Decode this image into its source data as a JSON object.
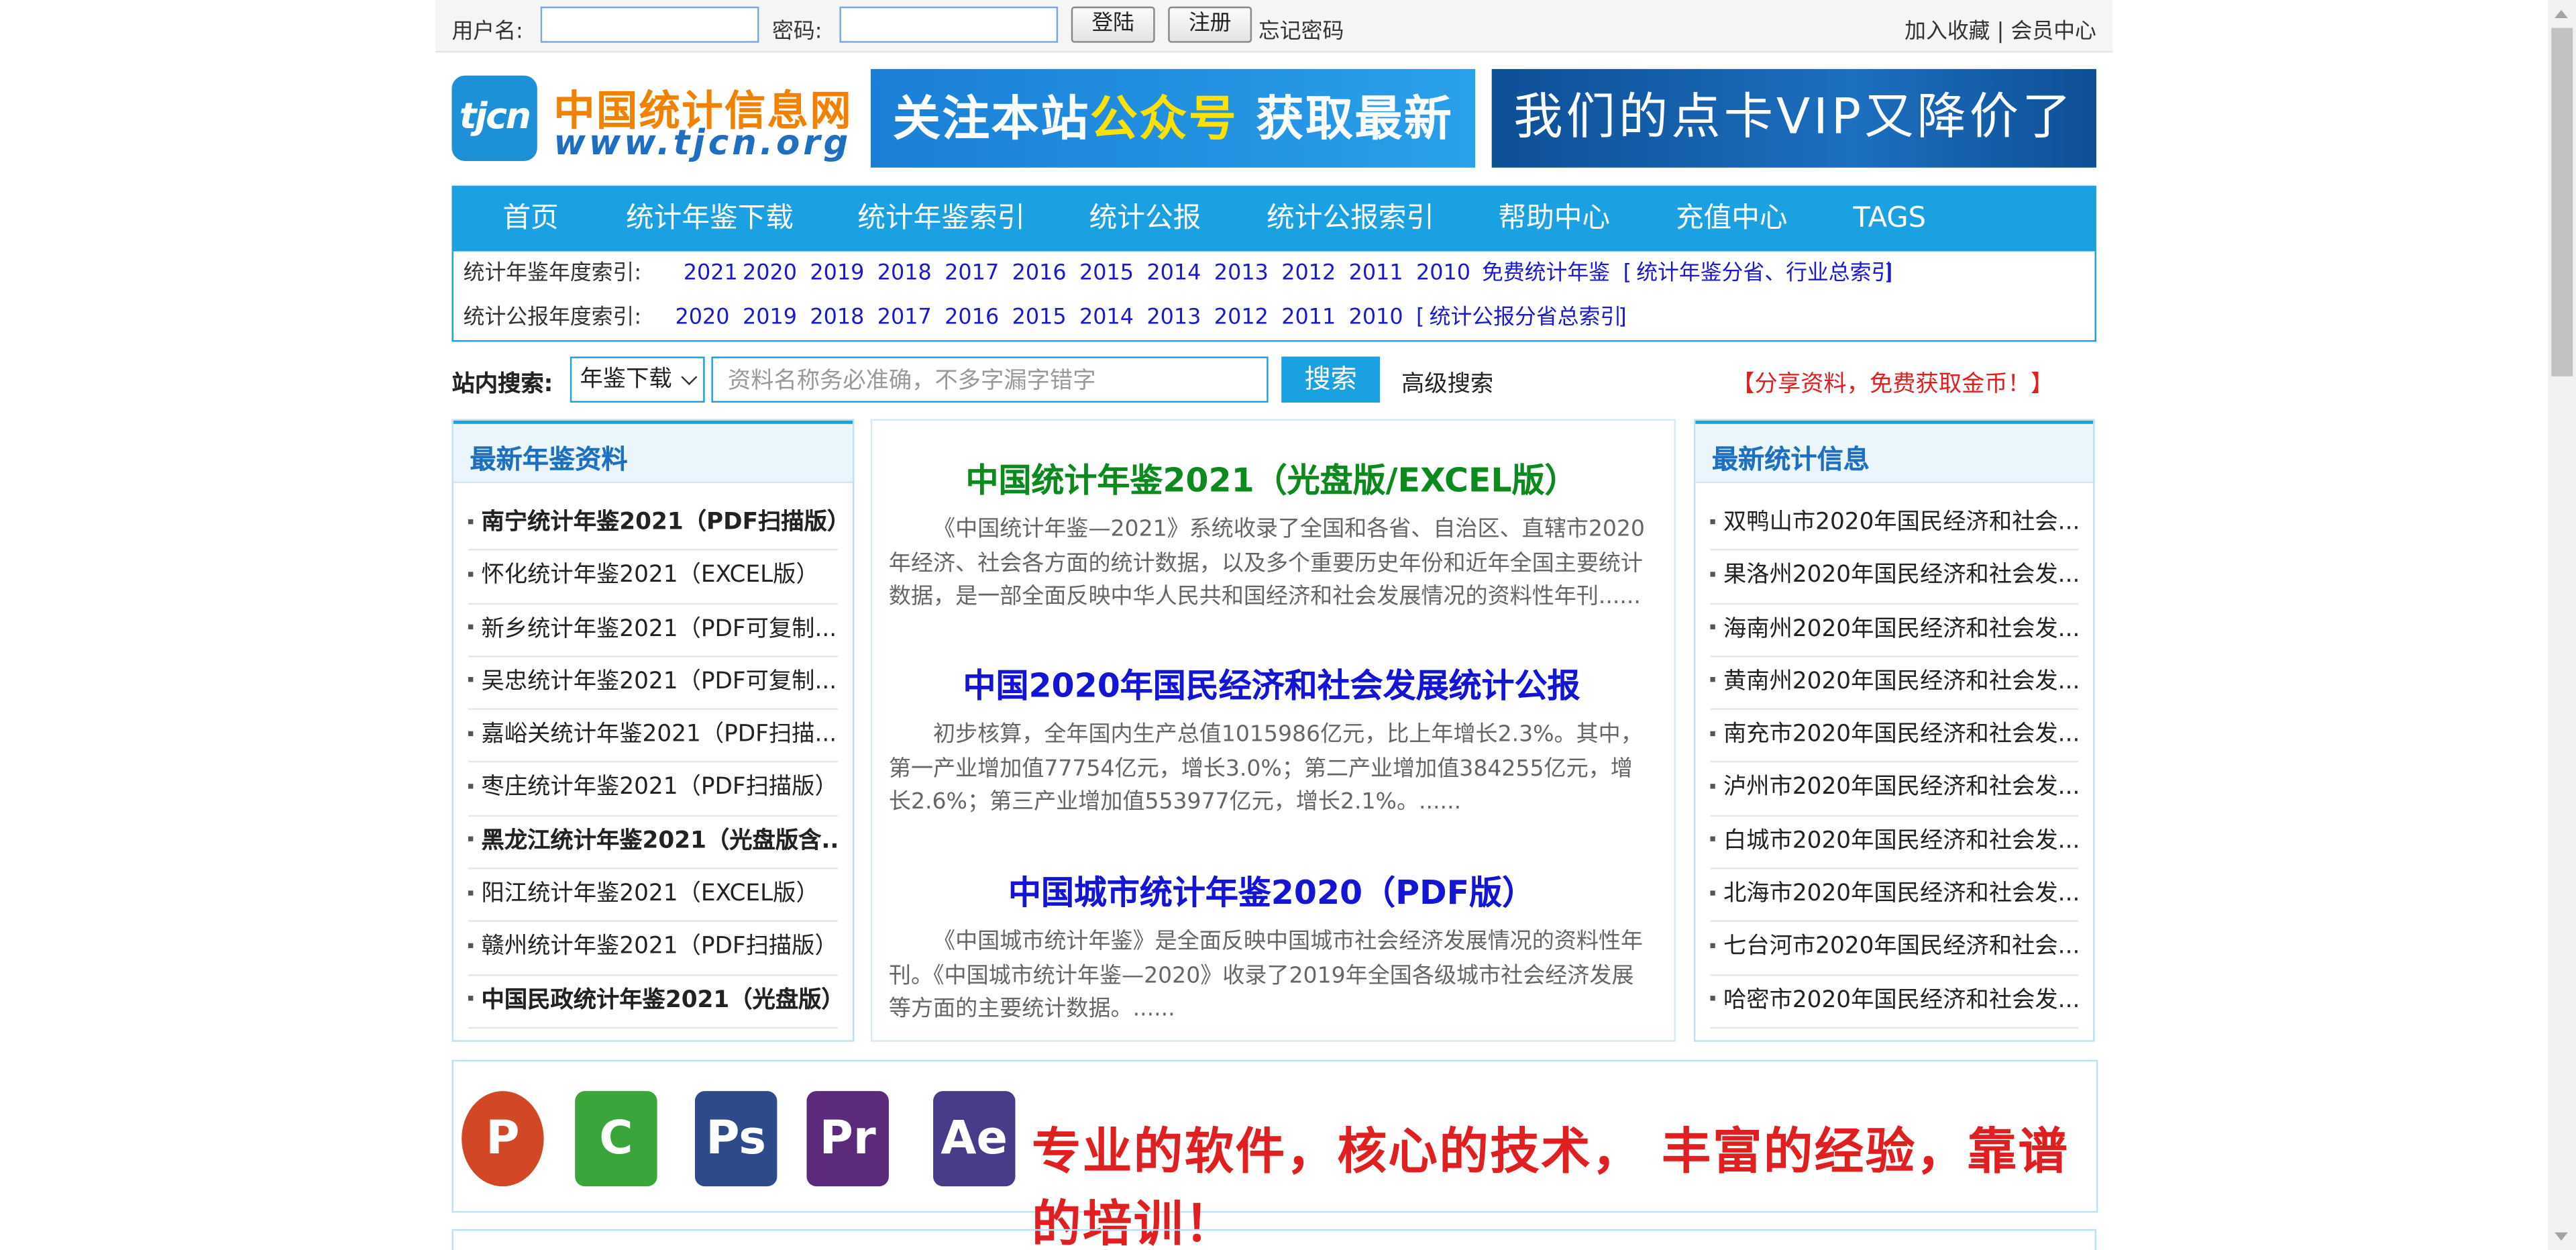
{
  "topbar": {
    "username_label": "用户名:",
    "password_label": "密码:",
    "login_label": "登陆",
    "register_label": "注册",
    "forgot_label": "忘记密码",
    "favorite_label": "加入收藏",
    "separator": " | ",
    "member_label": "会员中心"
  },
  "header": {
    "logo_mark": "tjcn",
    "logo_cn": "中国统计信息网",
    "logo_en": "www.tjcn.org",
    "banner1_pre": "关注本站",
    "banner1_hl": "公众号",
    "banner1_post": " 获取最新动态",
    "banner2": "我们的点卡VIP又降价了"
  },
  "nav": {
    "items": [
      "首页",
      "统计年鉴下载",
      "统计年鉴索引",
      "统计公报",
      "统计公报索引",
      "帮助中心",
      "充值中心",
      "TAGS"
    ]
  },
  "index": {
    "yearbook_label": "统计年鉴年度索引:",
    "yearbook_years": [
      "2021",
      "2020",
      "2019",
      "2018",
      "2017",
      "2016",
      "2015",
      "2014",
      "2013",
      "2012",
      "2011",
      "2010"
    ],
    "yearbook_free": "免费统计年鉴",
    "yearbook_total": "统计年鉴分省、行业总索引",
    "bulletin_label": "统计公报年度索引:",
    "bulletin_years": [
      "2020",
      "2019",
      "2018",
      "2017",
      "2016",
      "2015",
      "2014",
      "2013",
      "2012",
      "2011",
      "2010"
    ],
    "bulletin_total": "统计公报分省总索引",
    "bracket_open": "[",
    "bracket_close": "]"
  },
  "search": {
    "label": "站内搜索:",
    "select_value": "年鉴下载",
    "placeholder": "资料名称务必准确，不多字漏字错字",
    "button": "搜索",
    "advanced": "高级搜索",
    "promo": "【分享资料，免费获取金币！】"
  },
  "left_panel": {
    "title": "最新年鉴资料",
    "items": [
      {
        "text": "南宁统计年鉴2021（PDF扫描版）",
        "bold": true
      },
      {
        "text": "怀化统计年鉴2021（EXCEL版）",
        "bold": false
      },
      {
        "text": "新乡统计年鉴2021（PDF可复制...",
        "bold": false
      },
      {
        "text": "吴忠统计年鉴2021（PDF可复制...",
        "bold": false
      },
      {
        "text": "嘉峪关统计年鉴2021（PDF扫描...",
        "bold": false
      },
      {
        "text": "枣庄统计年鉴2021（PDF扫描版）",
        "bold": false
      },
      {
        "text": "黑龙江统计年鉴2021（光盘版含...",
        "bold": true
      },
      {
        "text": "阳江统计年鉴2021（EXCEL版）",
        "bold": false
      },
      {
        "text": "赣州统计年鉴2021（PDF扫描版）",
        "bold": false
      },
      {
        "text": "中国民政统计年鉴2021（光盘版）",
        "bold": true
      }
    ]
  },
  "center": {
    "articles": [
      {
        "title": "中国统计年鉴2021（光盘版/EXCEL版）",
        "color": "#0c8a1e",
        "desc": "《中国统计年鉴—2021》系统收录了全国和各省、自治区、直辖市2020年经济、社会各方面的统计数据，以及多个重要历史年份和近年全国主要统计数据，是一部全面反映中华人民共和国经济和社会发展情况的资料性年刊......"
      },
      {
        "title": "中国2020年国民经济和社会发展统计公报",
        "color": "#1414d4",
        "desc": "初步核算，全年国内生产总值1015986亿元，比上年增长2.3%。其中，第一产业增加值77754亿元，增长3.0%；第二产业增加值384255亿元，增长2.6%；第三产业增加值553977亿元，增长2.1%。......"
      },
      {
        "title": "中国城市统计年鉴2020（PDF版）",
        "color": "#1414d4",
        "desc": "《中国城市统计年鉴》是全面反映中国城市社会经济发展情况的资料性年刊。《中国城市统计年鉴—2020》收录了2019年全国各级城市社会经济发展等方面的主要统计数据。......"
      }
    ]
  },
  "right_panel": {
    "title": "最新统计信息",
    "items": [
      "双鸭山市2020年国民经济和社会...",
      "果洛州2020年国民经济和社会发...",
      "海南州2020年国民经济和社会发...",
      "黄南州2020年国民经济和社会发...",
      "南充市2020年国民经济和社会发...",
      "泸州市2020年国民经济和社会发...",
      "白城市2020年国民经济和社会发...",
      "北海市2020年国民经济和社会发...",
      "七台河市2020年国民经济和社会...",
      "哈密市2020年国民经济和社会发..."
    ]
  },
  "ad": {
    "icons": [
      {
        "name": "powerpoint-icon",
        "glyph": "P",
        "color": "#d24726"
      },
      {
        "name": "camtasia-icon",
        "glyph": "C",
        "color": "#3aa53a"
      },
      {
        "name": "photoshop-icon",
        "glyph": "Ps",
        "color": "#2f4a8a"
      },
      {
        "name": "premiere-icon",
        "glyph": "Pr",
        "color": "#5b2a7a"
      },
      {
        "name": "after-effects-icon",
        "glyph": "Ae",
        "color": "#4a3a8a"
      }
    ],
    "text": "专业的软件，核心的技术， 丰富的经验，靠谱的培训！"
  }
}
